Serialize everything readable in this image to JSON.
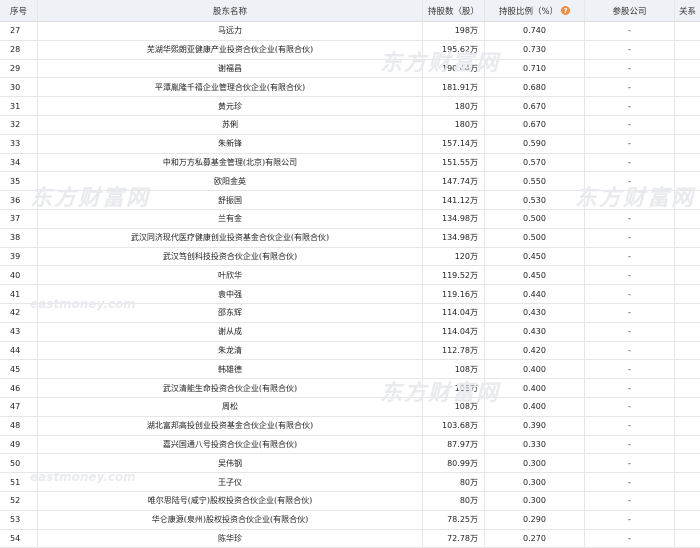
{
  "header": {
    "idx": "序号",
    "name": "股东名称",
    "shares": "持股数（股）",
    "ratio": "持股比例（%）",
    "ratio_help_icon": "?",
    "parent": "参股公司",
    "relation": "关系"
  },
  "rows": [
    {
      "idx": "27",
      "name": "马远力",
      "shares": "198万",
      "ratio": "0.740",
      "parent": "-"
    },
    {
      "idx": "28",
      "name": "芜湖华熙朗亚健康产业投资合伙企业(有限合伙)",
      "shares": "195.62万",
      "ratio": "0.730",
      "parent": "-"
    },
    {
      "idx": "29",
      "name": "谢福昌",
      "shares": "190.44万",
      "ratio": "0.710",
      "parent": "-"
    },
    {
      "idx": "30",
      "name": "平潭胤隆千禧企业管理合伙企业(有限合伙)",
      "shares": "181.91万",
      "ratio": "0.680",
      "parent": "-"
    },
    {
      "idx": "31",
      "name": "黄元珍",
      "shares": "180万",
      "ratio": "0.670",
      "parent": "-"
    },
    {
      "idx": "32",
      "name": "苏俐",
      "shares": "180万",
      "ratio": "0.670",
      "parent": "-"
    },
    {
      "idx": "33",
      "name": "朱新锋",
      "shares": "157.14万",
      "ratio": "0.590",
      "parent": "-"
    },
    {
      "idx": "34",
      "name": "中和万方私募基金管理(北京)有限公司",
      "shares": "151.55万",
      "ratio": "0.570",
      "parent": "-"
    },
    {
      "idx": "35",
      "name": "欧阳金英",
      "shares": "147.74万",
      "ratio": "0.550",
      "parent": "-"
    },
    {
      "idx": "36",
      "name": "舒振国",
      "shares": "141.12万",
      "ratio": "0.530",
      "parent": "-"
    },
    {
      "idx": "37",
      "name": "兰有金",
      "shares": "134.98万",
      "ratio": "0.500",
      "parent": "-"
    },
    {
      "idx": "38",
      "name": "武汉同济现代医疗健康创业投资基金合伙企业(有限合伙)",
      "shares": "134.98万",
      "ratio": "0.500",
      "parent": "-"
    },
    {
      "idx": "39",
      "name": "武汉笃创科技投资合伙企业(有限合伙)",
      "shares": "120万",
      "ratio": "0.450",
      "parent": "-"
    },
    {
      "idx": "40",
      "name": "叶欣华",
      "shares": "119.52万",
      "ratio": "0.450",
      "parent": "-"
    },
    {
      "idx": "41",
      "name": "袁中强",
      "shares": "119.16万",
      "ratio": "0.440",
      "parent": "-"
    },
    {
      "idx": "42",
      "name": "邵东辉",
      "shares": "114.04万",
      "ratio": "0.430",
      "parent": "-"
    },
    {
      "idx": "43",
      "name": "谢从成",
      "shares": "114.04万",
      "ratio": "0.430",
      "parent": "-"
    },
    {
      "idx": "44",
      "name": "朱龙清",
      "shares": "112.78万",
      "ratio": "0.420",
      "parent": "-"
    },
    {
      "idx": "45",
      "name": "韩雄德",
      "shares": "108万",
      "ratio": "0.400",
      "parent": "-"
    },
    {
      "idx": "46",
      "name": "武汉清能生命投资合伙企业(有限合伙)",
      "shares": "108万",
      "ratio": "0.400",
      "parent": "-"
    },
    {
      "idx": "47",
      "name": "周松",
      "shares": "108万",
      "ratio": "0.400",
      "parent": "-"
    },
    {
      "idx": "48",
      "name": "湖北富邦高投创业投资基金合伙企业(有限合伙)",
      "shares": "103.68万",
      "ratio": "0.390",
      "parent": "-"
    },
    {
      "idx": "49",
      "name": "嘉兴国通八号投资合伙企业(有限合伙)",
      "shares": "87.97万",
      "ratio": "0.330",
      "parent": "-"
    },
    {
      "idx": "50",
      "name": "吴伟钢",
      "shares": "80.99万",
      "ratio": "0.300",
      "parent": "-"
    },
    {
      "idx": "51",
      "name": "王子仪",
      "shares": "80万",
      "ratio": "0.300",
      "parent": "-"
    },
    {
      "idx": "52",
      "name": "唯尔思陆号(咸宁)股权投资合伙企业(有限合伙)",
      "shares": "80万",
      "ratio": "0.300",
      "parent": "-"
    },
    {
      "idx": "53",
      "name": "华仑康源(泉州)股权投资合伙企业(有限合伙)",
      "shares": "78.25万",
      "ratio": "0.290",
      "parent": "-"
    },
    {
      "idx": "54",
      "name": "陈华珍",
      "shares": "72.78万",
      "ratio": "0.270",
      "parent": "-"
    }
  ],
  "watermark": {
    "cn": "东方财富网",
    "en": "eastmoney.com"
  }
}
